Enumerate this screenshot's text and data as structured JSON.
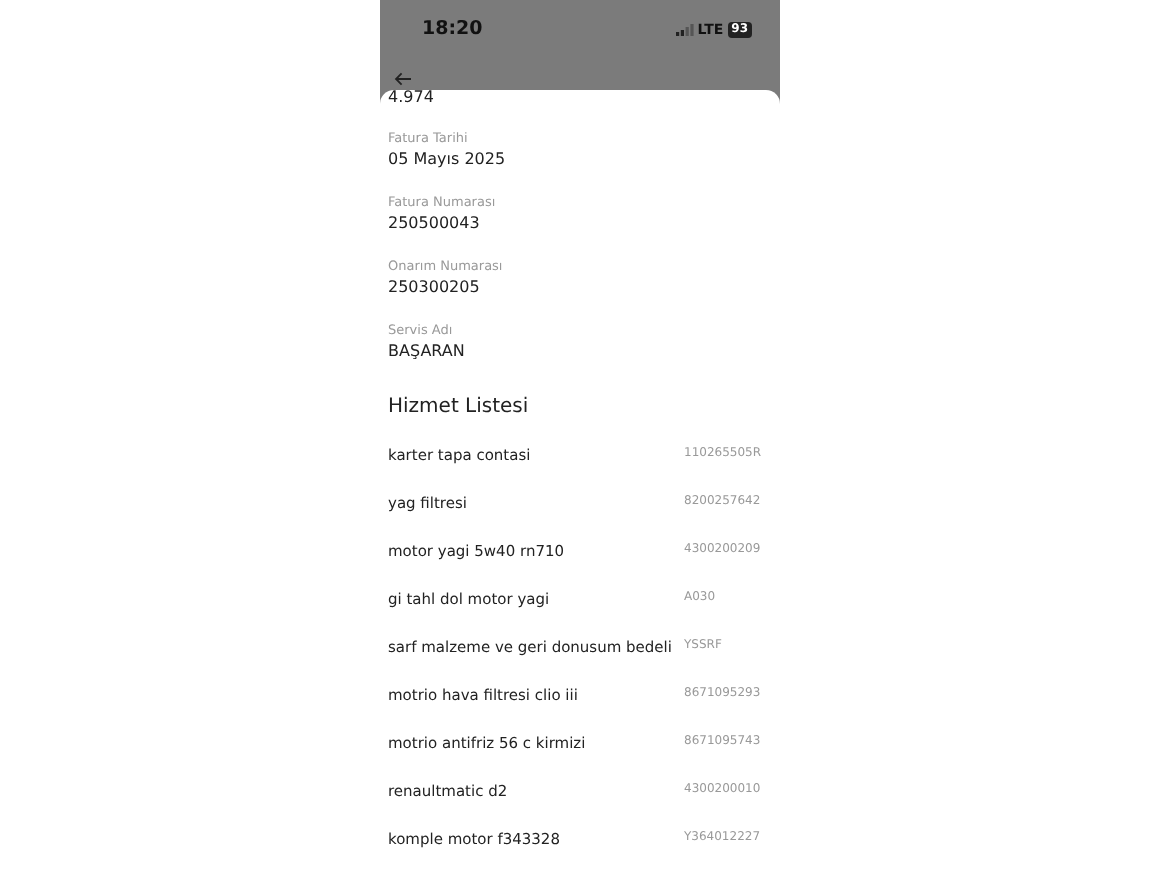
{
  "status_bar": {
    "time": "18:20",
    "network": "LTE",
    "battery": "93"
  },
  "partial_value": "4.974",
  "fields": [
    {
      "label": "Fatura Tarihi",
      "value": "05 Mayıs 2025"
    },
    {
      "label": "Fatura Numarası",
      "value": "250500043"
    },
    {
      "label": "Onarım Numarası",
      "value": "250300205"
    },
    {
      "label": "Servis Adı",
      "value": "BAŞARAN"
    }
  ],
  "section_title": "Hizmet Listesi",
  "services": [
    {
      "name": "karter tapa contasi",
      "code": "110265505R"
    },
    {
      "name": "yag filtresi",
      "code": "8200257642"
    },
    {
      "name": "motor yagi 5w40 rn710",
      "code": "4300200209"
    },
    {
      "name": "gi tahl dol motor yagi",
      "code": "A030"
    },
    {
      "name": "sarf malzeme ve geri donusum bedeli",
      "code": "YSSRF"
    },
    {
      "name": "motrio hava filtresi clio iii",
      "code": "8671095293"
    },
    {
      "name": "motrio antifriz  56 c kirmizi",
      "code": "8671095743"
    },
    {
      "name": "renaultmatic d2",
      "code": "4300200010"
    },
    {
      "name": "komple motor f343328",
      "code": "Y364012227"
    }
  ]
}
